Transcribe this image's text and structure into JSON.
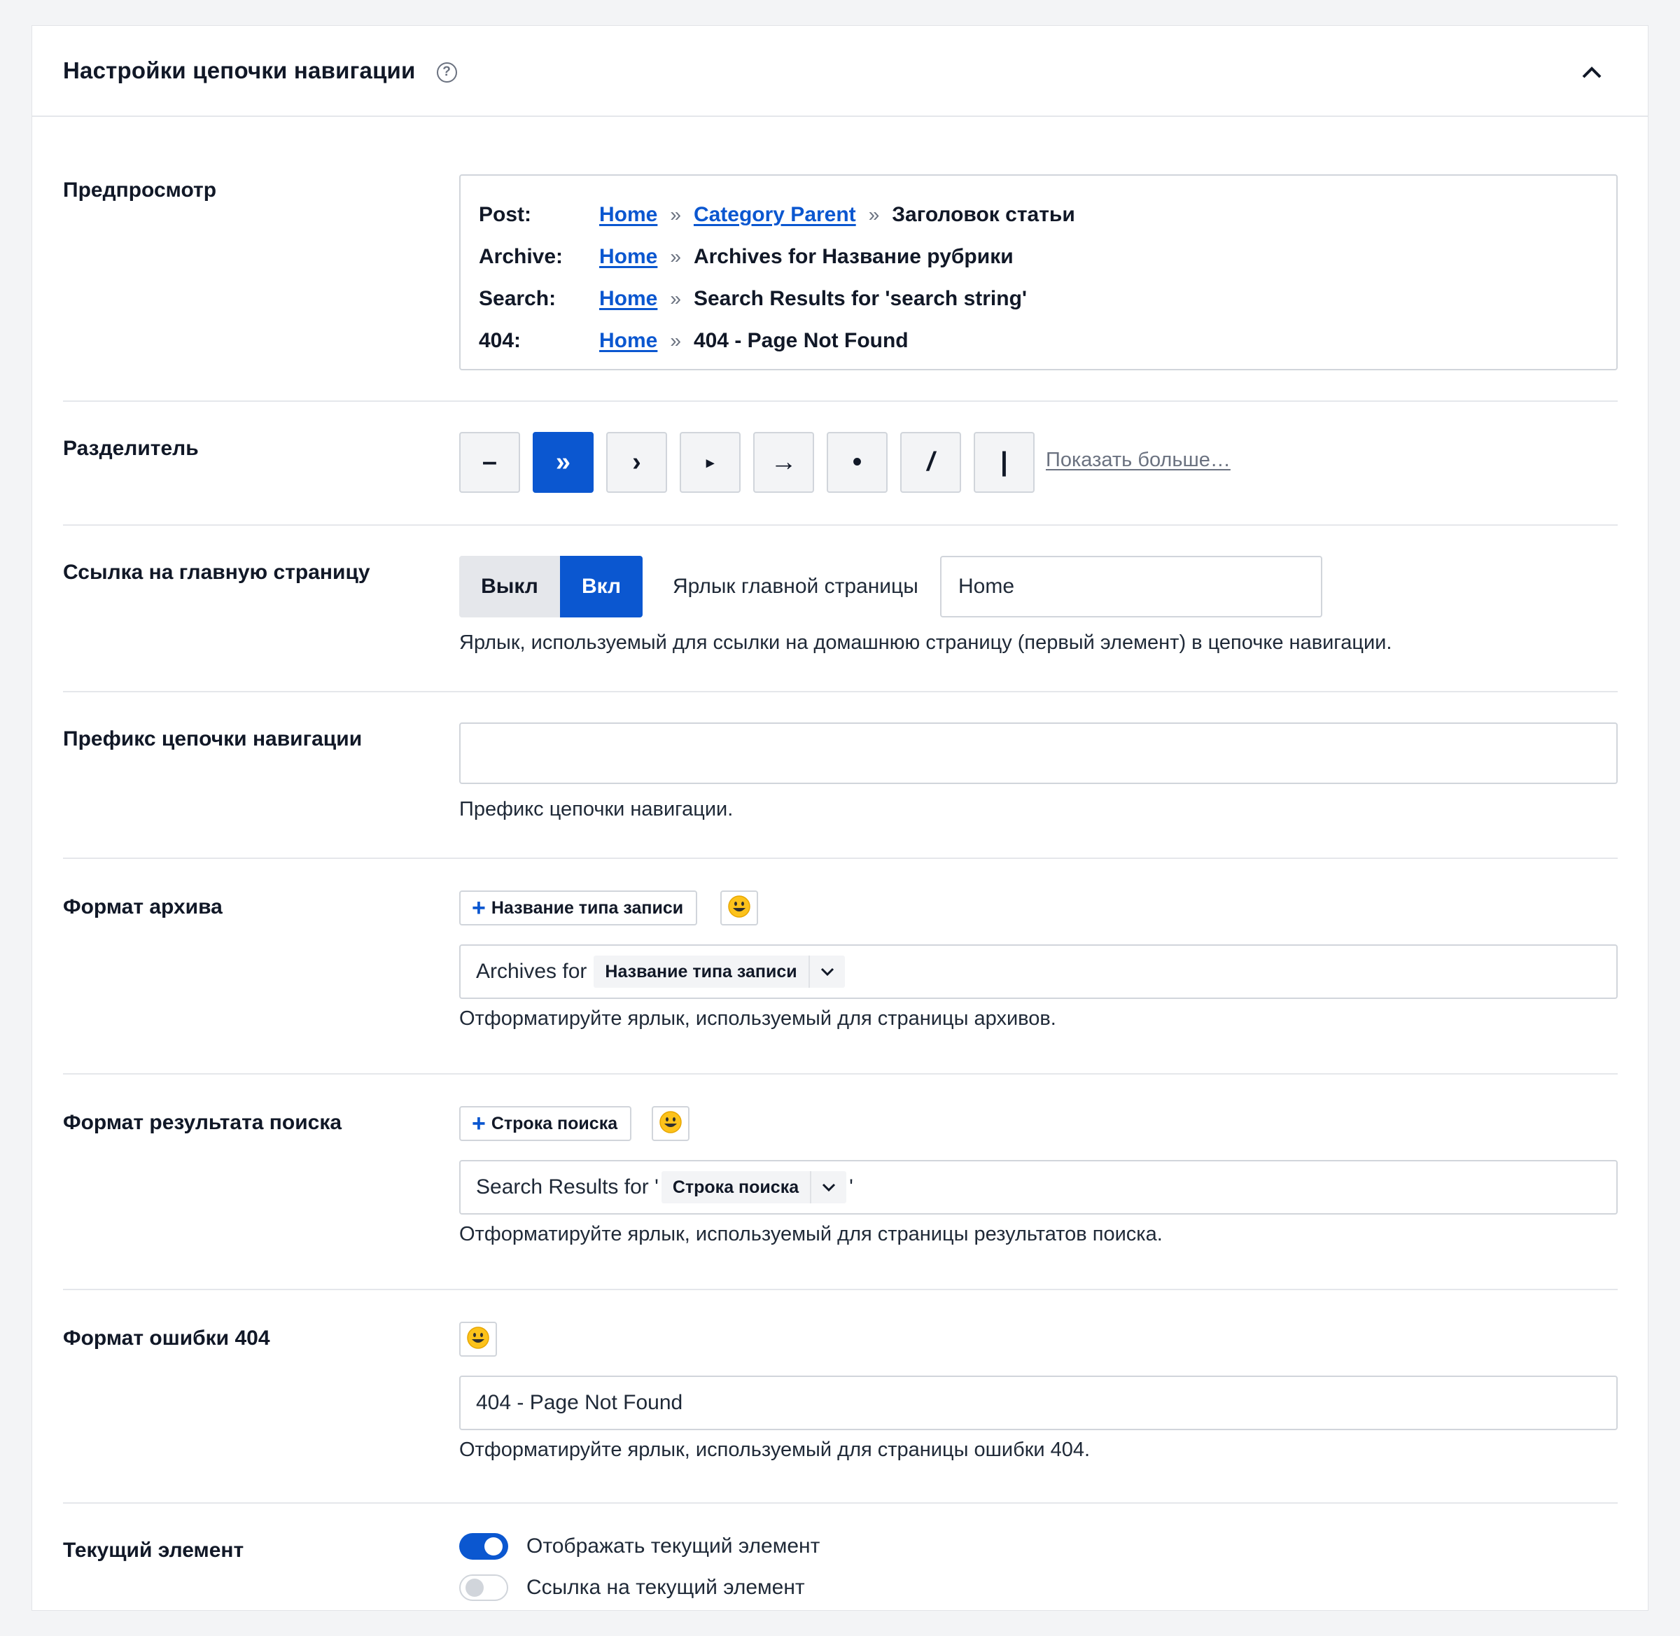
{
  "header": {
    "title": "Настройки цепочки навигации",
    "help_icon": "question-circle-icon",
    "collapse_icon": "chevron-up-icon"
  },
  "preview": {
    "label": "Предпросмотр",
    "lines": [
      {
        "label": "Post:",
        "home": "Home",
        "sep": "»",
        "parent": "Category Parent",
        "sep2": "»",
        "current": "Заголовок статьи"
      },
      {
        "label": "Archive:",
        "home": "Home",
        "sep": "»",
        "current": "Archives for Название рубрики"
      },
      {
        "label": "Search:",
        "home": "Home",
        "sep": "»",
        "current": "Search Results for 'search string'"
      },
      {
        "label": "404:",
        "home": "Home",
        "sep": "»",
        "current": "404 - Page Not Found"
      }
    ]
  },
  "separator": {
    "label": "Разделитель",
    "options": [
      "–",
      "»",
      "›",
      "▸",
      "→",
      "•",
      "/",
      "|"
    ],
    "selected": "»",
    "show_more": "Показать больше…"
  },
  "home_link": {
    "label": "Ссылка на главную страницу",
    "off_label": "Выкл",
    "on_label": "Вкл",
    "state": "on",
    "home_label_caption": "Ярлык главной страницы",
    "home_label_value": "Home",
    "help": "Ярлык, используемый для ссылки на домашнюю страницу (первый элемент) в цепочке навигации."
  },
  "prefix": {
    "label": "Префикс цепочки навигации",
    "value": "",
    "help": "Префикс цепочки навигации."
  },
  "archive_format": {
    "label": "Формат архива",
    "add_tag": "Название типа записи",
    "value_text": "Archives for",
    "chip": "Название типа записи",
    "help": "Отформатируйте ярлык, используемый для страницы архивов."
  },
  "search_format": {
    "label": "Формат результата поиска",
    "add_tag": "Строка поиска",
    "value_prefix": "Search Results for '",
    "chip": "Строка поиска",
    "value_suffix": "'",
    "help": "Отформатируйте ярлык, используемый для страницы результатов поиска."
  },
  "error_format": {
    "label": "Формат ошибки 404",
    "value": "404 - Page Not Found",
    "help": "Отформатируйте ярлык, используемый для страницы ошибки 404."
  },
  "current_item": {
    "label": "Текущий элемент",
    "show_label": "Отображать текущий элемент",
    "show_on": true,
    "link_label": "Ссылка на текущий элемент",
    "link_on": false
  },
  "colors": {
    "accent": "#0b57d0",
    "border": "#d1d5db",
    "background": "#f3f4f6"
  }
}
